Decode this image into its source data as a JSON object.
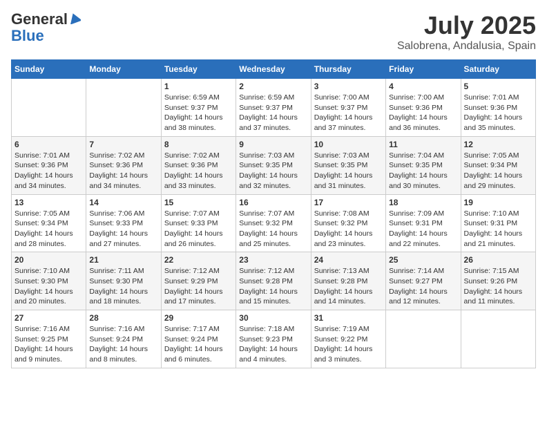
{
  "header": {
    "logo_general": "General",
    "logo_blue": "Blue",
    "month": "July 2025",
    "location": "Salobrena, Andalusia, Spain"
  },
  "days_of_week": [
    "Sunday",
    "Monday",
    "Tuesday",
    "Wednesday",
    "Thursday",
    "Friday",
    "Saturday"
  ],
  "weeks": [
    [
      {
        "day": "",
        "info": ""
      },
      {
        "day": "",
        "info": ""
      },
      {
        "day": "1",
        "info": "Sunrise: 6:59 AM\nSunset: 9:37 PM\nDaylight: 14 hours\nand 38 minutes."
      },
      {
        "day": "2",
        "info": "Sunrise: 6:59 AM\nSunset: 9:37 PM\nDaylight: 14 hours\nand 37 minutes."
      },
      {
        "day": "3",
        "info": "Sunrise: 7:00 AM\nSunset: 9:37 PM\nDaylight: 14 hours\nand 37 minutes."
      },
      {
        "day": "4",
        "info": "Sunrise: 7:00 AM\nSunset: 9:36 PM\nDaylight: 14 hours\nand 36 minutes."
      },
      {
        "day": "5",
        "info": "Sunrise: 7:01 AM\nSunset: 9:36 PM\nDaylight: 14 hours\nand 35 minutes."
      }
    ],
    [
      {
        "day": "6",
        "info": "Sunrise: 7:01 AM\nSunset: 9:36 PM\nDaylight: 14 hours\nand 34 minutes."
      },
      {
        "day": "7",
        "info": "Sunrise: 7:02 AM\nSunset: 9:36 PM\nDaylight: 14 hours\nand 34 minutes."
      },
      {
        "day": "8",
        "info": "Sunrise: 7:02 AM\nSunset: 9:36 PM\nDaylight: 14 hours\nand 33 minutes."
      },
      {
        "day": "9",
        "info": "Sunrise: 7:03 AM\nSunset: 9:35 PM\nDaylight: 14 hours\nand 32 minutes."
      },
      {
        "day": "10",
        "info": "Sunrise: 7:03 AM\nSunset: 9:35 PM\nDaylight: 14 hours\nand 31 minutes."
      },
      {
        "day": "11",
        "info": "Sunrise: 7:04 AM\nSunset: 9:35 PM\nDaylight: 14 hours\nand 30 minutes."
      },
      {
        "day": "12",
        "info": "Sunrise: 7:05 AM\nSunset: 9:34 PM\nDaylight: 14 hours\nand 29 minutes."
      }
    ],
    [
      {
        "day": "13",
        "info": "Sunrise: 7:05 AM\nSunset: 9:34 PM\nDaylight: 14 hours\nand 28 minutes."
      },
      {
        "day": "14",
        "info": "Sunrise: 7:06 AM\nSunset: 9:33 PM\nDaylight: 14 hours\nand 27 minutes."
      },
      {
        "day": "15",
        "info": "Sunrise: 7:07 AM\nSunset: 9:33 PM\nDaylight: 14 hours\nand 26 minutes."
      },
      {
        "day": "16",
        "info": "Sunrise: 7:07 AM\nSunset: 9:32 PM\nDaylight: 14 hours\nand 25 minutes."
      },
      {
        "day": "17",
        "info": "Sunrise: 7:08 AM\nSunset: 9:32 PM\nDaylight: 14 hours\nand 23 minutes."
      },
      {
        "day": "18",
        "info": "Sunrise: 7:09 AM\nSunset: 9:31 PM\nDaylight: 14 hours\nand 22 minutes."
      },
      {
        "day": "19",
        "info": "Sunrise: 7:10 AM\nSunset: 9:31 PM\nDaylight: 14 hours\nand 21 minutes."
      }
    ],
    [
      {
        "day": "20",
        "info": "Sunrise: 7:10 AM\nSunset: 9:30 PM\nDaylight: 14 hours\nand 20 minutes."
      },
      {
        "day": "21",
        "info": "Sunrise: 7:11 AM\nSunset: 9:30 PM\nDaylight: 14 hours\nand 18 minutes."
      },
      {
        "day": "22",
        "info": "Sunrise: 7:12 AM\nSunset: 9:29 PM\nDaylight: 14 hours\nand 17 minutes."
      },
      {
        "day": "23",
        "info": "Sunrise: 7:12 AM\nSunset: 9:28 PM\nDaylight: 14 hours\nand 15 minutes."
      },
      {
        "day": "24",
        "info": "Sunrise: 7:13 AM\nSunset: 9:28 PM\nDaylight: 14 hours\nand 14 minutes."
      },
      {
        "day": "25",
        "info": "Sunrise: 7:14 AM\nSunset: 9:27 PM\nDaylight: 14 hours\nand 12 minutes."
      },
      {
        "day": "26",
        "info": "Sunrise: 7:15 AM\nSunset: 9:26 PM\nDaylight: 14 hours\nand 11 minutes."
      }
    ],
    [
      {
        "day": "27",
        "info": "Sunrise: 7:16 AM\nSunset: 9:25 PM\nDaylight: 14 hours\nand 9 minutes."
      },
      {
        "day": "28",
        "info": "Sunrise: 7:16 AM\nSunset: 9:24 PM\nDaylight: 14 hours\nand 8 minutes."
      },
      {
        "day": "29",
        "info": "Sunrise: 7:17 AM\nSunset: 9:24 PM\nDaylight: 14 hours\nand 6 minutes."
      },
      {
        "day": "30",
        "info": "Sunrise: 7:18 AM\nSunset: 9:23 PM\nDaylight: 14 hours\nand 4 minutes."
      },
      {
        "day": "31",
        "info": "Sunrise: 7:19 AM\nSunset: 9:22 PM\nDaylight: 14 hours\nand 3 minutes."
      },
      {
        "day": "",
        "info": ""
      },
      {
        "day": "",
        "info": ""
      }
    ]
  ]
}
